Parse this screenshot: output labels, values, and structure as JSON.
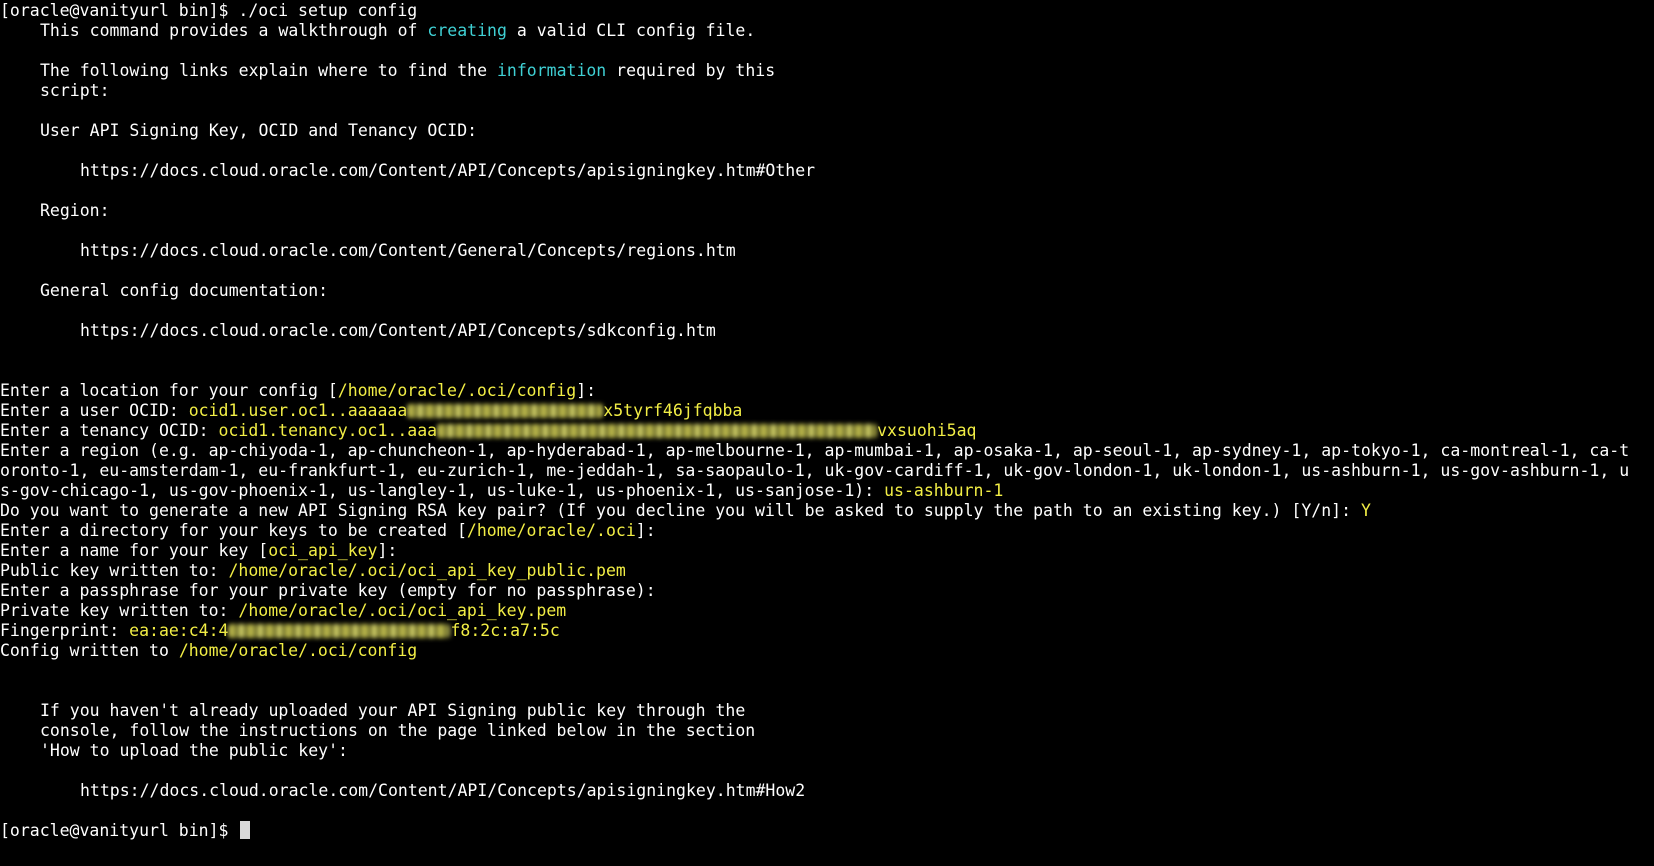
{
  "colors": {
    "background": "#000000",
    "text": "#ffffff",
    "highlight": "#3fd0d4",
    "value": "#f2ee45"
  },
  "cmd": {
    "prompt": "[oracle@vanityurl bin]$ ",
    "command": "./oci setup config"
  },
  "intro": {
    "l1a": "This command provides a walkthrough of ",
    "l1b": "creating",
    "l1c": " a valid CLI config file.",
    "l2a": "The following links explain where to find the ",
    "l2b": "information",
    "l2c": " required by this",
    "l3": "script:"
  },
  "links": {
    "user_heading": "User API Signing Key, OCID and Tenancy OCID:",
    "user_url": "https://docs.cloud.oracle.com/Content/API/Concepts/apisigningkey.htm#Other",
    "region_heading": "Region:",
    "region_url": "https://docs.cloud.oracle.com/Content/General/Concepts/regions.htm",
    "general_heading": "General config documentation:",
    "general_url": "https://docs.cloud.oracle.com/Content/API/Concepts/sdkconfig.htm"
  },
  "session": {
    "loc_a": "Enter a location for your config [",
    "loc_default": "/home/oracle/.oci/config",
    "loc_b": "]:",
    "user_label": "Enter a user OCID: ",
    "user_prefix": "ocid1.user.oc1..aaaaaa",
    "user_suffix": "x5tyrf46jfqbba",
    "tenancy_label": "Enter a tenancy OCID: ",
    "tenancy_prefix": "ocid1.tenancy.oc1..aaa",
    "tenancy_suffix": "vxsuohi5aq",
    "region_l1": "Enter a region (e.g. ap-chiyoda-1, ap-chuncheon-1, ap-hyderabad-1, ap-melbourne-1, ap-mumbai-1, ap-osaka-1, ap-seoul-1, ap-sydney-1, ap-tokyo-1, ca-montreal-1, ca-t",
    "region_l2": "oronto-1, eu-amsterdam-1, eu-frankfurt-1, eu-zurich-1, me-jeddah-1, sa-saopaulo-1, uk-gov-cardiff-1, uk-gov-london-1, uk-london-1, us-ashburn-1, us-gov-ashburn-1, u",
    "region_l3": "s-gov-chicago-1, us-gov-phoenix-1, us-langley-1, us-luke-1, us-phoenix-1, us-sanjose-1): ",
    "region_value": "us-ashburn-1",
    "generate_q": "Do you want to generate a new API Signing RSA key pair? (If you decline you will be asked to supply the path to an existing key.) [Y/n]: ",
    "generate_value": "Y",
    "dir_a": "Enter a directory for your keys to be created [",
    "dir_default": "/home/oracle/.oci",
    "dir_b": "]:",
    "name_a": "Enter a name for your key [",
    "name_default": "oci_api_key",
    "name_b": "]:",
    "pub_label": "Public key written to: ",
    "pub_path": "/home/oracle/.oci/oci_api_key_public.pem",
    "passphrase": "Enter a passphrase for your private key (empty for no passphrase):",
    "priv_label": "Private key written to: ",
    "priv_path": "/home/oracle/.oci/oci_api_key.pem",
    "fp_label": "Fingerprint: ",
    "fp_prefix": "ea:ae:c4:4",
    "fp_suffix": "f8:2c:a7:5c",
    "cfg_label": "Config written to ",
    "cfg_path": "/home/oracle/.oci/config"
  },
  "outro": {
    "l1": "If you haven't already uploaded your API Signing public key through the",
    "l2": "console, follow the instructions on the page linked below in the section",
    "l3": "'How to upload the public key':",
    "url": "https://docs.cloud.oracle.com/Content/API/Concepts/apisigningkey.htm#How2"
  },
  "final_prompt": "[oracle@vanityurl bin]$ "
}
